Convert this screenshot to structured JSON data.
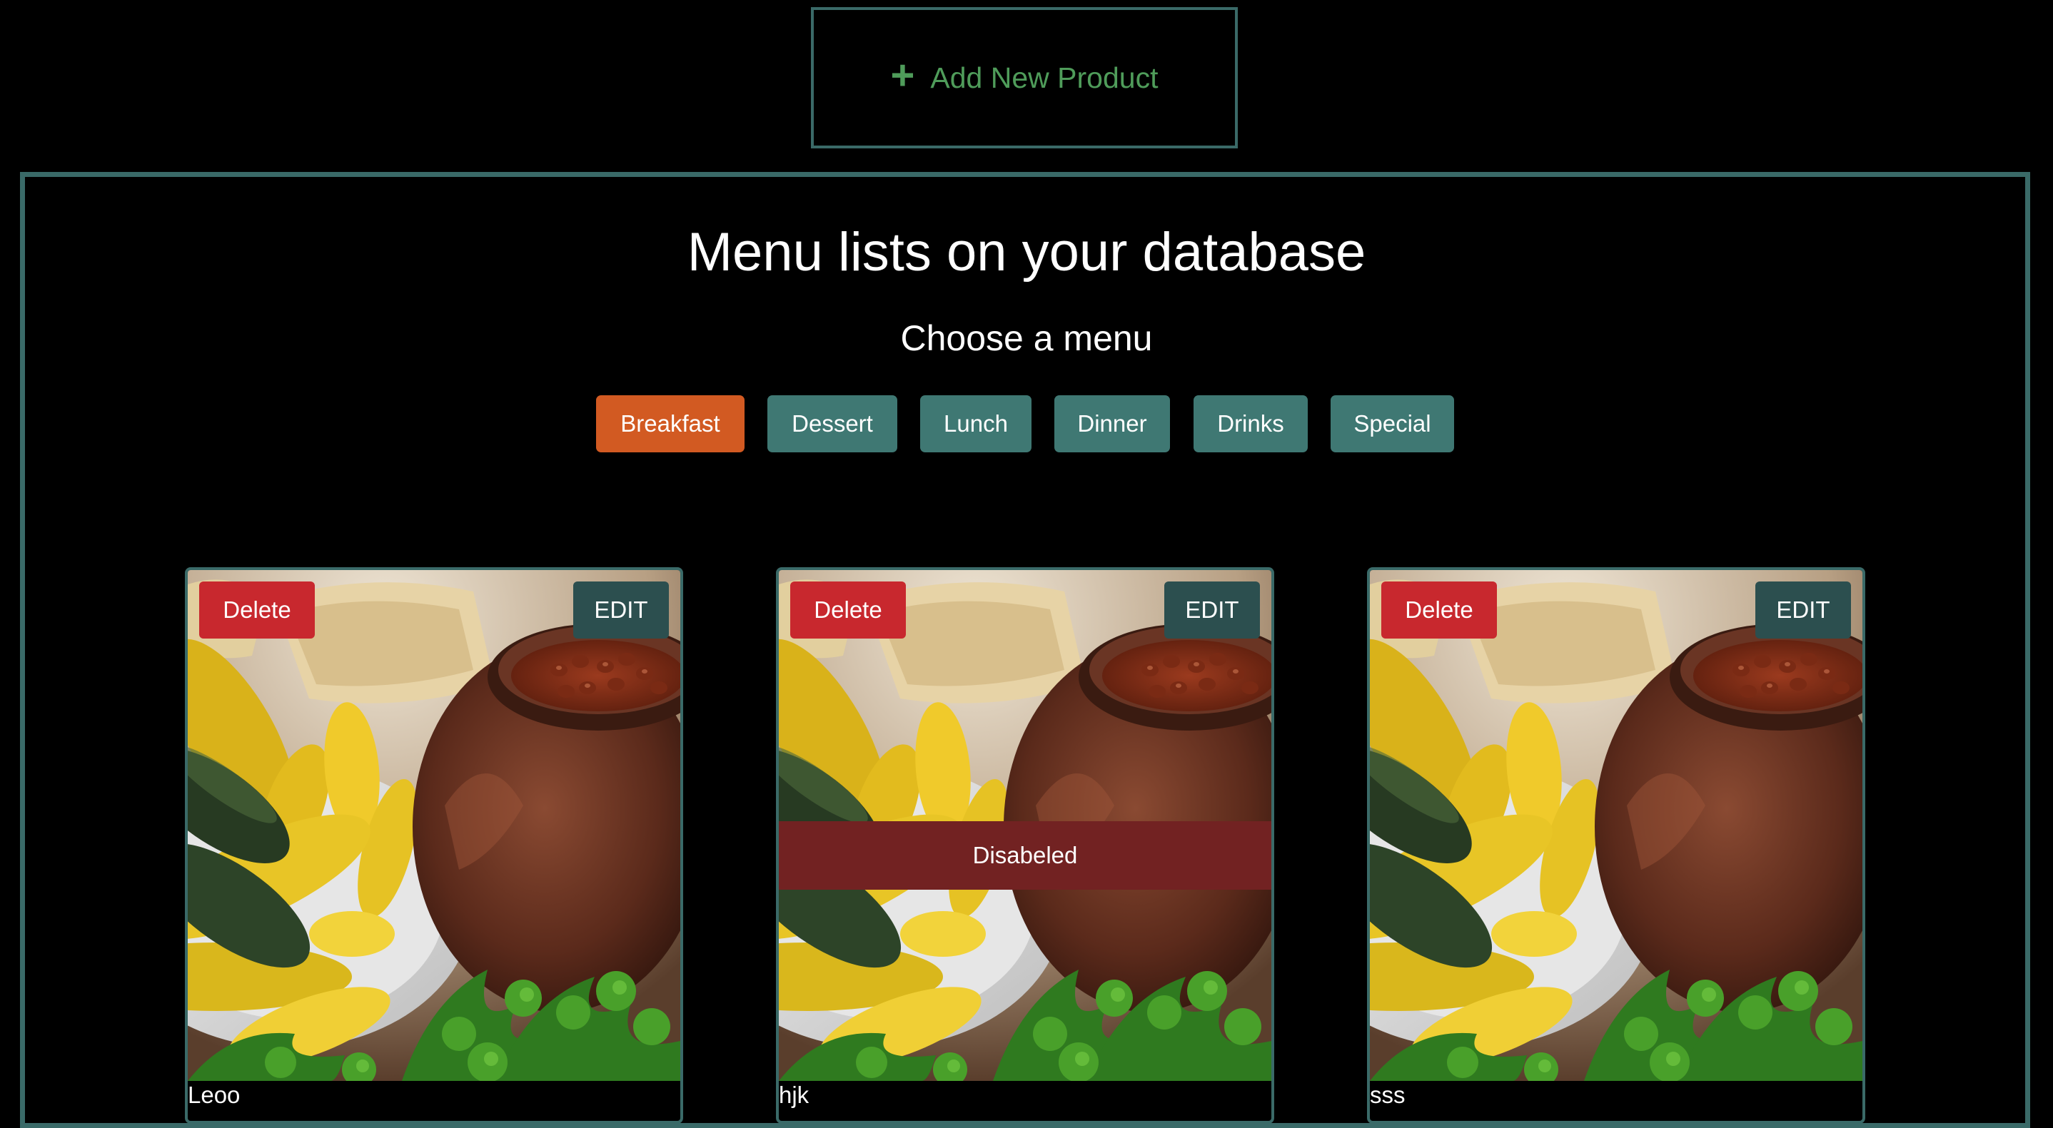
{
  "header": {
    "add_button_label": "Add New Product",
    "add_icon": "+"
  },
  "main": {
    "title": "Menu lists on your database",
    "subtitle": "Choose a menu",
    "categories": [
      {
        "label": "Breakfast",
        "active": true
      },
      {
        "label": "Dessert",
        "active": false
      },
      {
        "label": "Lunch",
        "active": false
      },
      {
        "label": "Dinner",
        "active": false
      },
      {
        "label": "Drinks",
        "active": false
      },
      {
        "label": "Special",
        "active": false
      }
    ],
    "products": [
      {
        "name": "Leoo",
        "delete_label": "Delete",
        "edit_label": "EDIT",
        "disabled": false
      },
      {
        "name": "hjk",
        "delete_label": "Delete",
        "edit_label": "EDIT",
        "disabled": true,
        "disabled_label": "Disabeled"
      },
      {
        "name": "sss",
        "delete_label": "Delete",
        "edit_label": "EDIT",
        "disabled": false
      }
    ]
  },
  "colors": {
    "background": "#000000",
    "border_teal": "#3a6a68",
    "add_text_green": "#4f9c5a",
    "category_active": "#d25a22",
    "category_inactive": "#3f7873",
    "delete_red": "#c8282e",
    "edit_dark_teal": "#2c4f4f",
    "disabled_banner": "#722222"
  }
}
